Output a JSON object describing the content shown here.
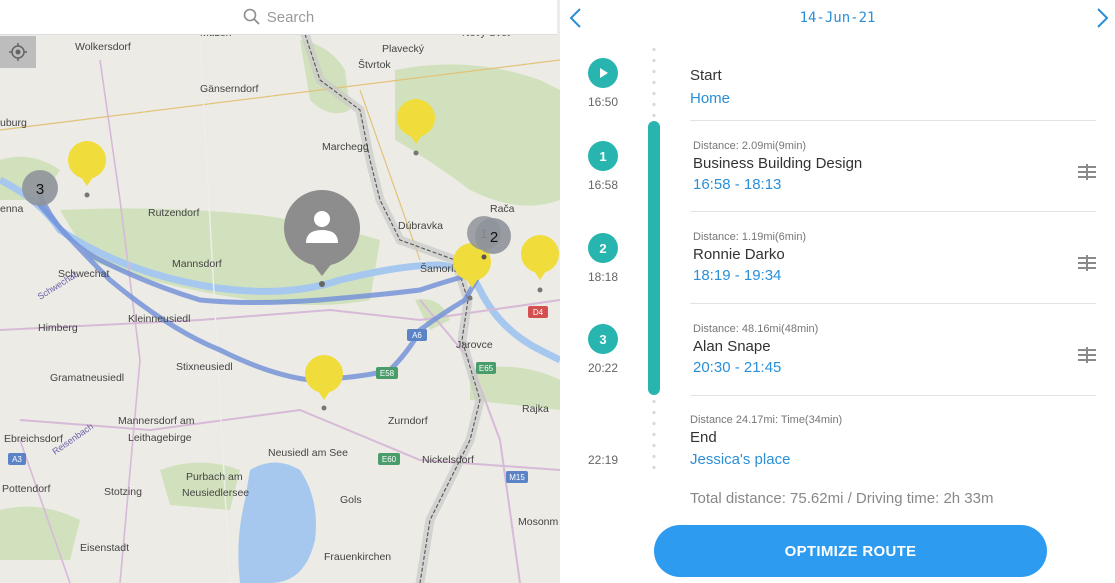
{
  "search": {
    "placeholder": "Search"
  },
  "map": {
    "labels": [
      {
        "text": "Wolkersdorf"
      },
      {
        "text": "Plavecký"
      },
      {
        "text": "Štvrtok"
      },
      {
        "text": "Gänserndorf"
      },
      {
        "text": "uburg"
      },
      {
        "text": "Marchegg"
      },
      {
        "text": "enna"
      },
      {
        "text": "Rutzendorf"
      },
      {
        "text": "Dúbravka"
      },
      {
        "text": "Rača"
      },
      {
        "text": "Mannsdorf"
      },
      {
        "text": "Schwechat"
      },
      {
        "text": "Himberg"
      },
      {
        "text": "Kleinneusiedl"
      },
      {
        "text": "Jarovce"
      },
      {
        "text": "Gramatneusiedl"
      },
      {
        "text": "Stixneusiedl"
      },
      {
        "text": "Rajka"
      },
      {
        "text": "Mannersdorf am"
      },
      {
        "text": "Leithagebirge"
      },
      {
        "text": "Zurndorf"
      },
      {
        "text": "Ebreichsdorf"
      },
      {
        "text": "Neusiedl am See"
      },
      {
        "text": "Nickelsdorf"
      },
      {
        "text": "Purbach am"
      },
      {
        "text": "Neusiedlersee"
      },
      {
        "text": "Pottendorf"
      },
      {
        "text": "Stotzing"
      },
      {
        "text": "Gols"
      },
      {
        "text": "Mosonm"
      },
      {
        "text": "Eisenstadt"
      },
      {
        "text": "Frauenkirchen"
      },
      {
        "text": "Šamorín"
      },
      {
        "text": "Nový Svet"
      },
      {
        "text": "Mužen"
      }
    ],
    "road_badges": [
      "A6",
      "E58",
      "E65",
      "A3",
      "E60",
      "M15",
      "D4",
      "Schwechat",
      "Reisenbach"
    ],
    "clusters": [
      {
        "count": "3"
      },
      {
        "count": "2"
      },
      {
        "count": "1"
      }
    ],
    "avatar_marker_icon": "user-icon",
    "colors": {
      "marker_yellow": "#f0dc3a",
      "cluster_gray": "#8f949a",
      "route_blue": "#6f8fd8"
    }
  },
  "header": {
    "date": "14-Jun-21",
    "prev_icon": "chevron-left-icon",
    "next_icon": "chevron-right-icon"
  },
  "timeline": {
    "start": {
      "icon": "play-icon",
      "time": "16:50"
    },
    "nodes": [
      {
        "number": "1",
        "time": "16:58"
      },
      {
        "number": "2",
        "time": "18:18"
      },
      {
        "number": "3",
        "time": "20:22"
      }
    ],
    "end_time": "22:19"
  },
  "stops": {
    "start": {
      "title": "Start",
      "place": "Home"
    },
    "items": [
      {
        "distance": "Distance: 2.09mi(9min)",
        "name": "Business Building Design",
        "time": "16:58 - 18:13"
      },
      {
        "distance": "Distance: 1.19mi(6min)",
        "name": "Ronnie Darko",
        "time": "18:19 - 19:34"
      },
      {
        "distance": "Distance: 48.16mi(48min)",
        "name": "Alan Snape",
        "time": "20:30 - 21:45"
      }
    ],
    "end": {
      "distance": "Distance 24.17mi:  Time(34min)",
      "title": "End",
      "place": "Jessica's place"
    }
  },
  "summary": "Total distance: 75.62mi / Driving time: 2h 33m",
  "optimize_button": "OPTIMIZE ROUTE",
  "colors": {
    "accent_blue": "#2a8fd8",
    "teal": "#28b5b0",
    "button_blue": "#2d9cf0"
  }
}
